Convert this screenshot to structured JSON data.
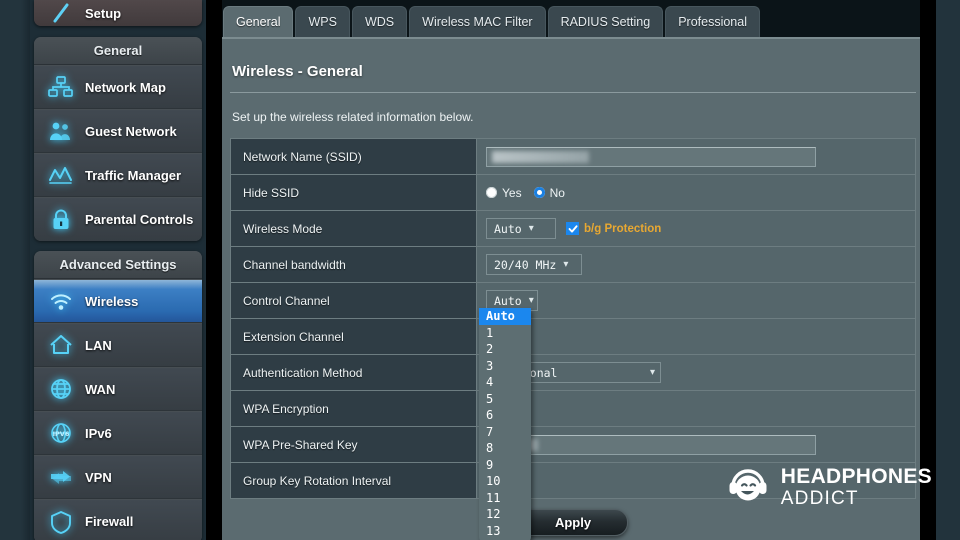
{
  "sidebar": {
    "setup": {
      "label": "Setup",
      "icon": "wand-icon"
    },
    "groups": [
      {
        "title": "General",
        "items": [
          {
            "label": "Network Map",
            "icon": "network-map-icon",
            "active": false
          },
          {
            "label": "Guest Network",
            "icon": "guest-network-icon",
            "active": false
          },
          {
            "label": "Traffic Manager",
            "icon": "traffic-manager-icon",
            "active": false
          },
          {
            "label": "Parental Controls",
            "icon": "parental-controls-icon",
            "active": false
          }
        ]
      },
      {
        "title": "Advanced Settings",
        "items": [
          {
            "label": "Wireless",
            "icon": "wifi-icon",
            "active": true
          },
          {
            "label": "LAN",
            "icon": "home-icon",
            "active": false
          },
          {
            "label": "WAN",
            "icon": "globe-icon",
            "active": false
          },
          {
            "label": "IPv6",
            "icon": "ipv6-icon",
            "active": false
          },
          {
            "label": "VPN",
            "icon": "vpn-icon",
            "active": false
          },
          {
            "label": "Firewall",
            "icon": "shield-icon",
            "active": false
          }
        ]
      }
    ]
  },
  "tabs": [
    {
      "label": "General",
      "active": true
    },
    {
      "label": "WPS",
      "active": false
    },
    {
      "label": "WDS",
      "active": false
    },
    {
      "label": "Wireless MAC Filter",
      "active": false
    },
    {
      "label": "RADIUS Setting",
      "active": false
    },
    {
      "label": "Professional",
      "active": false
    }
  ],
  "page": {
    "title": "Wireless - General",
    "description": "Set up the wireless related information below."
  },
  "form": {
    "rows": [
      {
        "label": "Network Name (SSID)",
        "type": "text",
        "value": ""
      },
      {
        "label": "Hide SSID",
        "type": "radio",
        "options": [
          "Yes",
          "No"
        ],
        "selected": "No"
      },
      {
        "label": "Wireless Mode",
        "type": "select-check",
        "value": "Auto",
        "checkbox_label": "b/g Protection",
        "checkbox_checked": true
      },
      {
        "label": "Channel bandwidth",
        "type": "select",
        "value": "20/40 MHz"
      },
      {
        "label": "Control Channel",
        "type": "select-open",
        "value": "Auto"
      },
      {
        "label": "Extension Channel",
        "type": "select",
        "value": ""
      },
      {
        "label": "Authentication Method",
        "type": "select",
        "value": "ersonal"
      },
      {
        "label": "WPA Encryption",
        "type": "select",
        "value": ""
      },
      {
        "label": "WPA Pre-Shared Key",
        "type": "text",
        "value": ""
      },
      {
        "label": "Group Key Rotation Interval",
        "type": "text",
        "value": ""
      }
    ]
  },
  "control_channel_dropdown": {
    "open": true,
    "selected": "Auto",
    "options": [
      "Auto",
      "1",
      "2",
      "3",
      "4",
      "5",
      "6",
      "7",
      "8",
      "9",
      "10",
      "11",
      "12",
      "13"
    ]
  },
  "apply_button": {
    "label": "Apply"
  },
  "watermark": {
    "line1": "HEADPHONES",
    "line2": "ADDICT",
    "icon": "headphones-smiley-icon"
  },
  "colors": {
    "accent_blue": "#1b87ee",
    "active_sidebar": "#2a6ab0",
    "panel_bg": "#5b6b70",
    "label_bg": "#2f3d45",
    "checkbox_label": "#e8a832",
    "page_bg": "#22333c"
  }
}
